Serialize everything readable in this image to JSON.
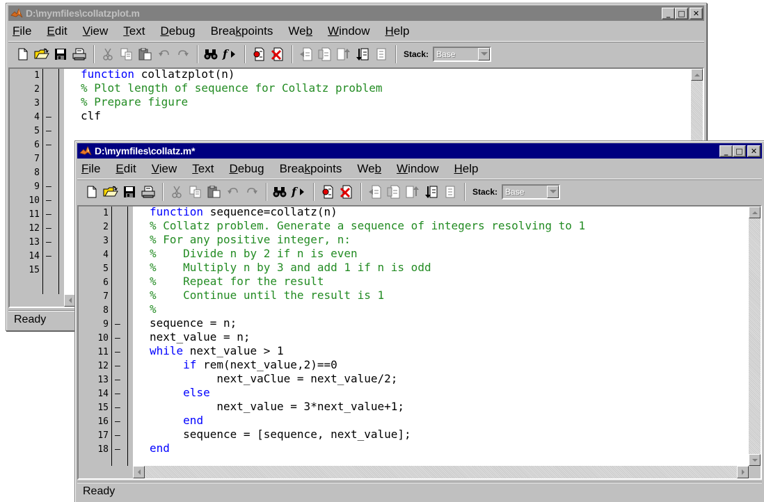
{
  "back_window": {
    "title": "D:\\mymfiles\\collatzplot.m",
    "menu": [
      "File",
      "Edit",
      "View",
      "Text",
      "Debug",
      "Breakpoints",
      "Web",
      "Window",
      "Help"
    ],
    "stack_label": "Stack:",
    "stack_value": "Base",
    "status": "Ready",
    "lines": [
      {
        "num": "1",
        "dash": "",
        "segments": [
          {
            "t": "function ",
            "c": "kw"
          },
          {
            "t": "collatzplot(n)",
            "c": "tx"
          }
        ]
      },
      {
        "num": "2",
        "dash": "",
        "segments": [
          {
            "t": "% Plot length of sequence for Collatz problem",
            "c": "cm"
          }
        ]
      },
      {
        "num": "3",
        "dash": "",
        "segments": [
          {
            "t": "% Prepare figure",
            "c": "cm"
          }
        ]
      },
      {
        "num": "4",
        "dash": "–",
        "segments": [
          {
            "t": "clf",
            "c": "tx"
          }
        ]
      },
      {
        "num": "5",
        "dash": "–",
        "segments": []
      },
      {
        "num": "6",
        "dash": "–",
        "segments": []
      },
      {
        "num": "7",
        "dash": "",
        "segments": []
      },
      {
        "num": "8",
        "dash": "",
        "segments": []
      },
      {
        "num": "9",
        "dash": "–",
        "segments": []
      },
      {
        "num": "10",
        "dash": "–",
        "segments": []
      },
      {
        "num": "11",
        "dash": "–",
        "segments": []
      },
      {
        "num": "12",
        "dash": "–",
        "segments": []
      },
      {
        "num": "13",
        "dash": "–",
        "segments": []
      },
      {
        "num": "14",
        "dash": "–",
        "segments": []
      },
      {
        "num": "15",
        "dash": "",
        "segments": []
      }
    ]
  },
  "front_window": {
    "title": "D:\\mymfiles\\collatz.m*",
    "menu": [
      "File",
      "Edit",
      "View",
      "Text",
      "Debug",
      "Breakpoints",
      "Web",
      "Window",
      "Help"
    ],
    "stack_label": "Stack:",
    "stack_value": "Base",
    "status": "Ready",
    "lines": [
      {
        "num": "1",
        "dash": "",
        "segments": [
          {
            "t": "function ",
            "c": "kw"
          },
          {
            "t": "sequence=collatz(n)",
            "c": "tx"
          }
        ]
      },
      {
        "num": "2",
        "dash": "",
        "segments": [
          {
            "t": "% Collatz problem. Generate a sequence of integers resolving to 1",
            "c": "cm"
          }
        ]
      },
      {
        "num": "3",
        "dash": "",
        "segments": [
          {
            "t": "% For any positive integer, n:",
            "c": "cm"
          }
        ]
      },
      {
        "num": "4",
        "dash": "",
        "segments": [
          {
            "t": "%    Divide n by 2 if n is even",
            "c": "cm"
          }
        ]
      },
      {
        "num": "5",
        "dash": "",
        "segments": [
          {
            "t": "%    Multiply n by 3 and add 1 if n is odd",
            "c": "cm"
          }
        ]
      },
      {
        "num": "6",
        "dash": "",
        "segments": [
          {
            "t": "%    Repeat for the result",
            "c": "cm"
          }
        ]
      },
      {
        "num": "7",
        "dash": "",
        "segments": [
          {
            "t": "%    Continue until the result is 1",
            "c": "cm"
          }
        ]
      },
      {
        "num": "8",
        "dash": "",
        "segments": [
          {
            "t": "%",
            "c": "cm"
          }
        ]
      },
      {
        "num": "9",
        "dash": "–",
        "segments": [
          {
            "t": "sequence = n;",
            "c": "tx"
          }
        ]
      },
      {
        "num": "10",
        "dash": "–",
        "segments": [
          {
            "t": "next_value = n;",
            "c": "tx"
          }
        ]
      },
      {
        "num": "11",
        "dash": "–",
        "segments": [
          {
            "t": "while ",
            "c": "kw"
          },
          {
            "t": "next_value > 1",
            "c": "tx"
          }
        ]
      },
      {
        "num": "12",
        "dash": "–",
        "segments": [
          {
            "t": "     ",
            "c": "tx"
          },
          {
            "t": "if ",
            "c": "kw"
          },
          {
            "t": "rem(next_value,2)==0",
            "c": "tx"
          }
        ]
      },
      {
        "num": "13",
        "dash": "–",
        "segments": [
          {
            "t": "          next_vaClue = next_value/2;",
            "c": "tx"
          }
        ]
      },
      {
        "num": "14",
        "dash": "–",
        "segments": [
          {
            "t": "     ",
            "c": "tx"
          },
          {
            "t": "else",
            "c": "kw"
          }
        ]
      },
      {
        "num": "15",
        "dash": "–",
        "segments": [
          {
            "t": "          next_value = 3*next_value+1;",
            "c": "tx"
          }
        ]
      },
      {
        "num": "16",
        "dash": "–",
        "segments": [
          {
            "t": "     ",
            "c": "tx"
          },
          {
            "t": "end",
            "c": "kw"
          }
        ]
      },
      {
        "num": "17",
        "dash": "–",
        "segments": [
          {
            "t": "     sequence = [sequence, next_value];",
            "c": "tx"
          }
        ]
      },
      {
        "num": "18",
        "dash": "–",
        "segments": [
          {
            "t": "end",
            "c": "kw"
          }
        ]
      }
    ]
  },
  "toolbar_icons": [
    "new-file-icon",
    "open-folder-icon",
    "save-icon",
    "print-icon",
    "cut-icon",
    "copy-icon",
    "paste-icon",
    "undo-icon",
    "redo-icon",
    "find-icon",
    "function-browser-icon",
    "set-breakpoint-icon",
    "clear-breakpoints-icon",
    "step-icon",
    "step-in-icon",
    "step-out-icon",
    "continue-icon",
    "exit-debug-icon"
  ],
  "colors": {
    "active_title": "#000080",
    "inactive_title": "#808080",
    "keyword": "#0000ff",
    "comment": "#228b22"
  }
}
